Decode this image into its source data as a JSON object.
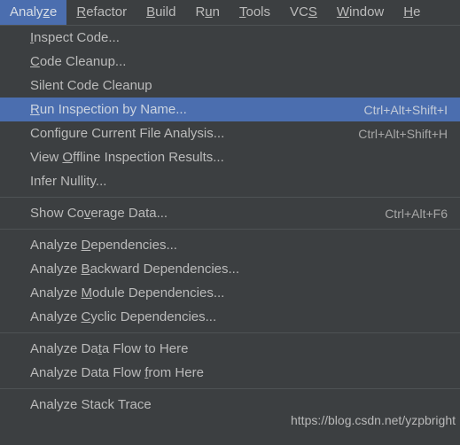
{
  "colors": {
    "window_bg": "#3c3f41",
    "menu_bg": "#3c3f41",
    "highlight": "#4b6eaf",
    "text": "#bbbbbb",
    "highlight_text": "#ccd4e0",
    "separator": "#4e5254",
    "shortcut_text": "#a7a7a7",
    "watermark_text": "#b9b9b9"
  },
  "menubar": {
    "items": [
      {
        "label": "Analyze",
        "mnemonic": "z",
        "active": true
      },
      {
        "label": "Refactor",
        "mnemonic": "R",
        "active": false
      },
      {
        "label": "Build",
        "mnemonic": "B",
        "active": false
      },
      {
        "label": "Run",
        "mnemonic": "u",
        "active": false
      },
      {
        "label": "Tools",
        "mnemonic": "T",
        "active": false
      },
      {
        "label": "VCS",
        "mnemonic": "S",
        "active": false
      },
      {
        "label": "Window",
        "mnemonic": "W",
        "active": false
      },
      {
        "label": "He",
        "mnemonic": "H",
        "active": false
      }
    ]
  },
  "menu": {
    "open_menu": "Analyze",
    "items": [
      {
        "type": "item",
        "label": "Inspect Code...",
        "mnemonic": "I",
        "shortcut": "",
        "selected": false
      },
      {
        "type": "item",
        "label": "Code Cleanup...",
        "mnemonic": "C",
        "shortcut": "",
        "selected": false
      },
      {
        "type": "item",
        "label": "Silent Code Cleanup",
        "mnemonic": "",
        "shortcut": "",
        "selected": false
      },
      {
        "type": "item",
        "label": "Run Inspection by Name...",
        "mnemonic": "R",
        "shortcut": "Ctrl+Alt+Shift+I",
        "selected": true
      },
      {
        "type": "item",
        "label": "Configure Current File Analysis...",
        "mnemonic": "",
        "shortcut": "Ctrl+Alt+Shift+H",
        "selected": false
      },
      {
        "type": "item",
        "label": "View Offline Inspection Results...",
        "mnemonic": "O",
        "shortcut": "",
        "selected": false
      },
      {
        "type": "item",
        "label": "Infer Nullity...",
        "mnemonic": "",
        "shortcut": "",
        "selected": false
      },
      {
        "type": "separator"
      },
      {
        "type": "item",
        "label": "Show Coverage Data...",
        "mnemonic": "v",
        "shortcut": "Ctrl+Alt+F6",
        "selected": false
      },
      {
        "type": "separator"
      },
      {
        "type": "item",
        "label": "Analyze Dependencies...",
        "mnemonic": "D",
        "shortcut": "",
        "selected": false
      },
      {
        "type": "item",
        "label": "Analyze Backward Dependencies...",
        "mnemonic": "B",
        "shortcut": "",
        "selected": false
      },
      {
        "type": "item",
        "label": "Analyze Module Dependencies...",
        "mnemonic": "M",
        "shortcut": "",
        "selected": false
      },
      {
        "type": "item",
        "label": "Analyze Cyclic Dependencies...",
        "mnemonic": "C",
        "shortcut": "",
        "selected": false
      },
      {
        "type": "separator"
      },
      {
        "type": "item",
        "label": "Analyze Data Flow to Here",
        "mnemonic": "t",
        "shortcut": "",
        "selected": false
      },
      {
        "type": "item",
        "label": "Analyze Data Flow from Here",
        "mnemonic": "f",
        "shortcut": "",
        "selected": false
      },
      {
        "type": "separator"
      },
      {
        "type": "item",
        "label": "Analyze Stack Trace",
        "mnemonic": "",
        "shortcut": "",
        "selected": false
      }
    ]
  },
  "watermark": {
    "text": "https://blog.csdn.net/yzpbright"
  }
}
